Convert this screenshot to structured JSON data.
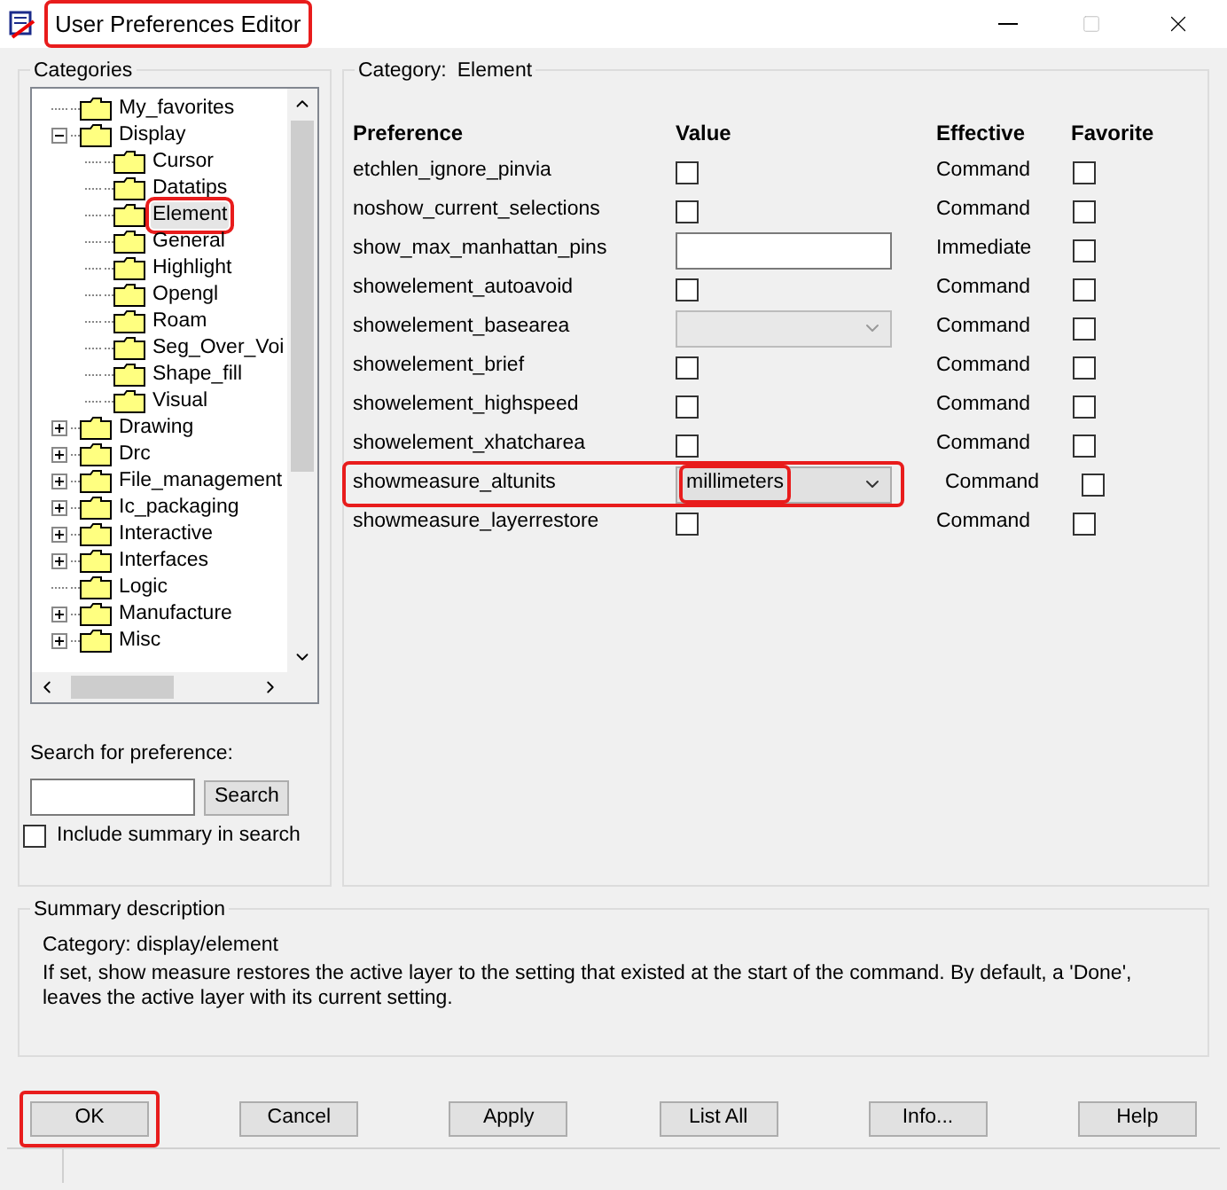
{
  "window": {
    "title": "User Preferences Editor",
    "highlighted": true
  },
  "categories": {
    "title": "Categories",
    "tree": [
      {
        "label": "My_favorites",
        "kind": "leaf",
        "selected": false
      },
      {
        "label": "Display",
        "kind": "group",
        "expanded": true,
        "selected": false,
        "children": [
          {
            "label": "Cursor",
            "kind": "leaf",
            "selected": false
          },
          {
            "label": "Datatips",
            "kind": "leaf",
            "selected": false
          },
          {
            "label": "Element",
            "kind": "leaf",
            "selected": true,
            "highlighted": true
          },
          {
            "label": "General",
            "kind": "leaf",
            "selected": false
          },
          {
            "label": "Highlight",
            "kind": "leaf",
            "selected": false
          },
          {
            "label": "Opengl",
            "kind": "leaf",
            "selected": false
          },
          {
            "label": "Roam",
            "kind": "leaf",
            "selected": false
          },
          {
            "label": "Seg_Over_Voi",
            "kind": "leaf",
            "selected": false
          },
          {
            "label": "Shape_fill",
            "kind": "leaf",
            "selected": false
          },
          {
            "label": "Visual",
            "kind": "leaf",
            "selected": false
          }
        ]
      },
      {
        "label": "Drawing",
        "kind": "group",
        "expanded": false,
        "selected": false
      },
      {
        "label": "Drc",
        "kind": "group",
        "expanded": false,
        "selected": false
      },
      {
        "label": "File_management",
        "kind": "group",
        "expanded": false,
        "selected": false
      },
      {
        "label": "Ic_packaging",
        "kind": "group",
        "expanded": false,
        "selected": false
      },
      {
        "label": "Interactive",
        "kind": "group",
        "expanded": false,
        "selected": false
      },
      {
        "label": "Interfaces",
        "kind": "group",
        "expanded": false,
        "selected": false
      },
      {
        "label": "Logic",
        "kind": "leaf",
        "selected": false
      },
      {
        "label": "Manufacture",
        "kind": "group",
        "expanded": false,
        "selected": false
      },
      {
        "label": "Misc",
        "kind": "group",
        "expanded": false,
        "selected": false
      }
    ],
    "search_label": "Search for preference:",
    "search_button": "Search",
    "include_summary": {
      "label": "Include summary in search",
      "checked": false
    }
  },
  "preferences": {
    "category_label": "Category:",
    "category": "Element",
    "columns": [
      "Preference",
      "Value",
      "Effective",
      "Favorite"
    ],
    "rows": [
      {
        "name": "etchlen_ignore_pinvia",
        "kind": "checkbox",
        "checked": false,
        "effective": "Command",
        "favorite": false
      },
      {
        "name": "noshow_current_selections",
        "kind": "checkbox",
        "checked": false,
        "effective": "Command",
        "favorite": false
      },
      {
        "name": "show_max_manhattan_pins",
        "kind": "text",
        "effective": "Immediate",
        "favorite": false
      },
      {
        "name": "showelement_autoavoid",
        "kind": "checkbox",
        "checked": false,
        "effective": "Command",
        "favorite": false
      },
      {
        "name": "showelement_basearea",
        "kind": "select",
        "disabled": true,
        "effective": "Command",
        "favorite": false
      },
      {
        "name": "showelement_brief",
        "kind": "checkbox",
        "checked": false,
        "effective": "Command",
        "favorite": false
      },
      {
        "name": "showelement_highspeed",
        "kind": "checkbox",
        "checked": false,
        "effective": "Command",
        "favorite": false
      },
      {
        "name": "showelement_xhatcharea",
        "kind": "checkbox",
        "checked": false,
        "effective": "Command",
        "favorite": false
      },
      {
        "name": "showmeasure_altunits",
        "kind": "select",
        "disabled": false,
        "value": "millimeters",
        "effective": "Command",
        "favorite": false,
        "highlighted": true
      },
      {
        "name": "showmeasure_layerrestore",
        "kind": "checkbox",
        "checked": false,
        "effective": "Command",
        "favorite": false
      }
    ]
  },
  "summary": {
    "title": "Summary description",
    "category": "Category: display/element",
    "text": "If set, show measure restores the active layer to the setting that existed at the start of the command. By default, a 'Done', leaves the active layer with its current setting."
  },
  "buttons": [
    {
      "label": "OK",
      "highlighted": true
    },
    {
      "label": "Cancel",
      "highlighted": false
    },
    {
      "label": "Apply",
      "highlighted": false
    },
    {
      "label": "List All",
      "highlighted": false
    },
    {
      "label": "Info...",
      "highlighted": false
    },
    {
      "label": "Help",
      "highlighted": false
    }
  ]
}
